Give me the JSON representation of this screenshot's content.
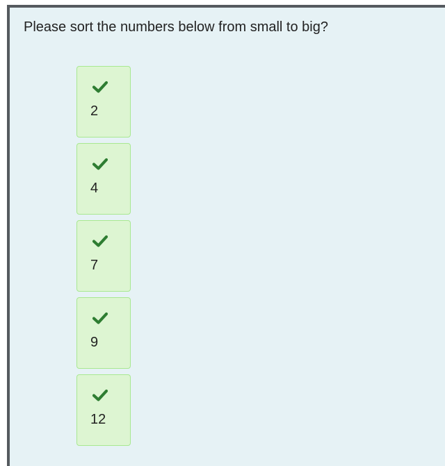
{
  "question": {
    "text": "Please sort the numbers below from small to big?"
  },
  "items": [
    {
      "value": "2",
      "status_icon": "check-icon",
      "correct": true
    },
    {
      "value": "4",
      "status_icon": "check-icon",
      "correct": true
    },
    {
      "value": "7",
      "status_icon": "check-icon",
      "correct": true
    },
    {
      "value": "9",
      "status_icon": "check-icon",
      "correct": true
    },
    {
      "value": "12",
      "status_icon": "check-icon",
      "correct": true
    }
  ],
  "colors": {
    "panel_background": "#e6f2f5",
    "panel_border": "#555a5f",
    "item_background": "#ddf5d2",
    "item_border": "#a8e890",
    "check": "#2e7d32",
    "text": "#222222"
  }
}
